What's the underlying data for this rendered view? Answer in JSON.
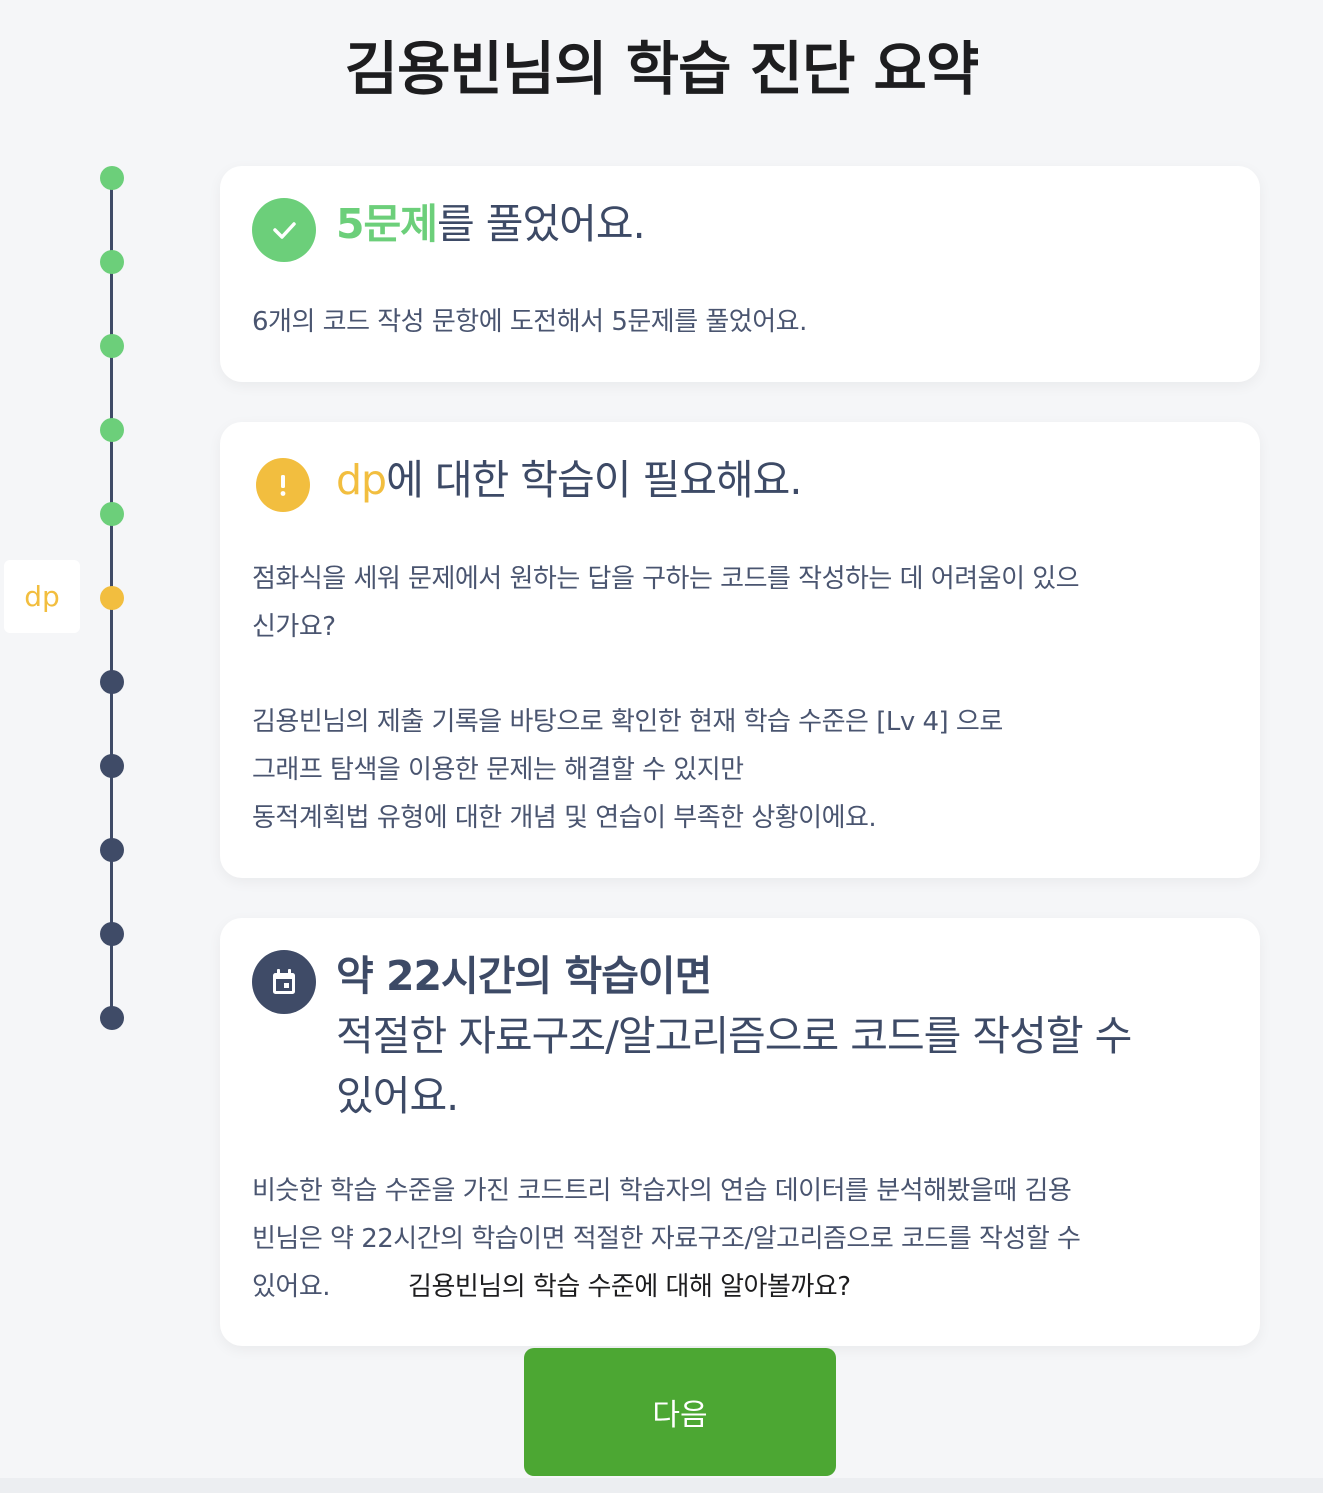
{
  "page_title": "김용빈님의 학습 진단 요약",
  "colors": {
    "green": "#6ccf7a",
    "yellow": "#f2be3f",
    "navy": "#3f4b67",
    "button": "#4ca733"
  },
  "timeline": {
    "active_tag": "dp",
    "dots": [
      {
        "status": "complete"
      },
      {
        "status": "complete"
      },
      {
        "status": "complete"
      },
      {
        "status": "complete"
      },
      {
        "status": "complete"
      },
      {
        "status": "current"
      },
      {
        "status": "pending"
      },
      {
        "status": "pending"
      },
      {
        "status": "pending"
      },
      {
        "status": "pending"
      },
      {
        "status": "pending"
      }
    ]
  },
  "cards": {
    "solved": {
      "icon": "check-circle-icon",
      "heading_highlight": "5문제",
      "heading_rest": "를 풀었어요.",
      "body": "6개의 코드 작성 문항에 도전해서 5문제를 풀었어요."
    },
    "needs": {
      "icon": "exclamation-circle-icon",
      "heading_highlight": "dp",
      "heading_rest": "에 대한 학습이 필요해요.",
      "body_line1": "점화식을 세워 문제에서 원하는 답을 구하는 코드를 작성하는 데 어려움이 있으",
      "body_line2": "신가요?",
      "body_line3": "김용빈님의 제출 기록을 바탕으로 확인한 현재 학습 수준은 [Lv 4] 으로",
      "body_line4": "그래프 탐색을 이용한 문제는 해결할 수 있지만",
      "body_line5": "동적계획법 유형에 대한 개념 및 연습이 부족한 상황이에요."
    },
    "plan": {
      "icon": "calendar-icon",
      "heading_line1": "약 22시간의 학습이면",
      "heading_line2": "적절한 자료구조/알고리즘으로 코드를 작성할 수",
      "heading_line3": "있어요.",
      "body_line1": "비슷한 학습 수준을 가진 코드트리 학습자의 연습 데이터를 분석해봤을때 김용",
      "body_line2": "빈님은 약 22시간의 학습이면 적절한 자료구조/알고리즘으로 코드를 작성할 수",
      "body_line3": "있어요.",
      "body_tail": "김용빈님의 학습 수준에 대해 알아볼까요?"
    }
  },
  "next_button": "다음"
}
